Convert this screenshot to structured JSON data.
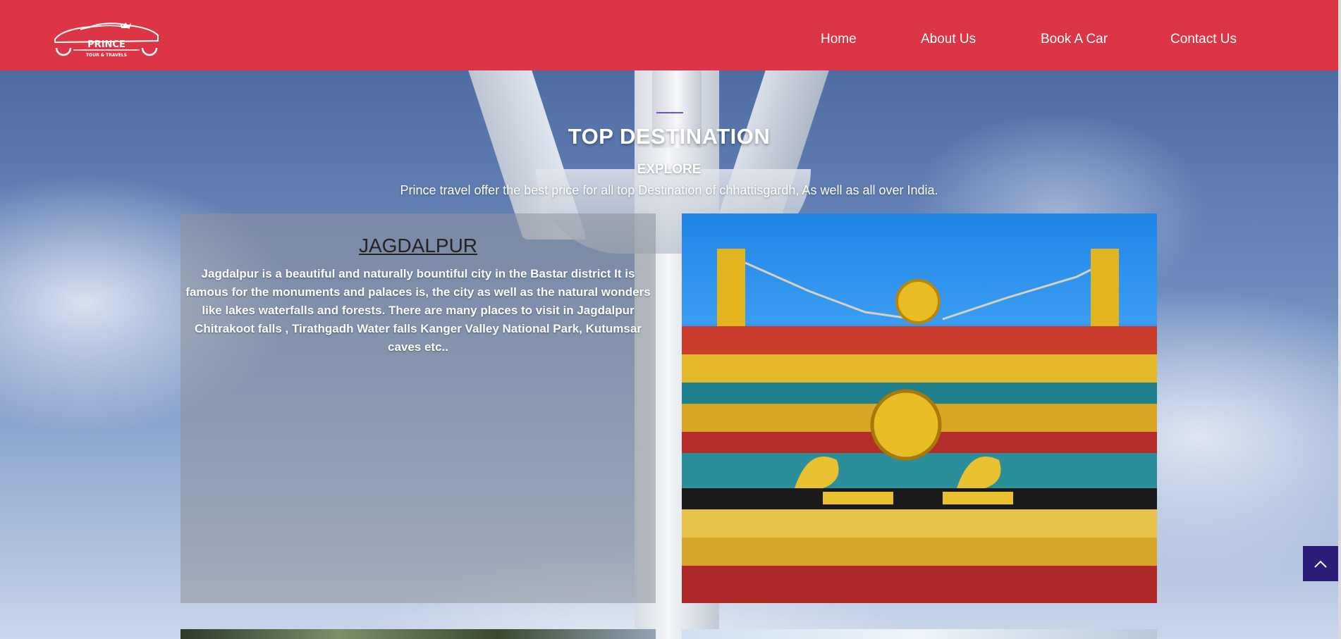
{
  "brand": {
    "name": "PRINCE",
    "tagline": "TOUR & TRAVELS"
  },
  "nav": {
    "items": [
      {
        "label": "Home"
      },
      {
        "label": "About Us"
      },
      {
        "label": "Book A Car"
      },
      {
        "label": "Contact Us"
      }
    ]
  },
  "section": {
    "title": "TOP DESTINATION",
    "subtitle": "EXPLORE",
    "description": "Prince travel offer the best price for all top Destination of chhattisgardh, As well as all over India."
  },
  "destinations": [
    {
      "name": "JAGDALPUR",
      "description": "Jagdalpur is a beautiful and naturally bountiful city in the Bastar district It is famous for the monuments and palaces is, the city as well as the natural wonders like lakes waterfalls and forests. There are many places to visit in Jagdalpur Chitrakoot falls , Tirathgadh Water falls Kanger Valley National Park, Kutumsar caves etc.."
    }
  ],
  "colors": {
    "header": "#dc3545",
    "back_to_top": "#2a1e7a",
    "accent_rule": "#6b4fd8"
  },
  "icons": {
    "back_to_top": "chevron-up-icon",
    "logo": "car-logo-icon"
  }
}
